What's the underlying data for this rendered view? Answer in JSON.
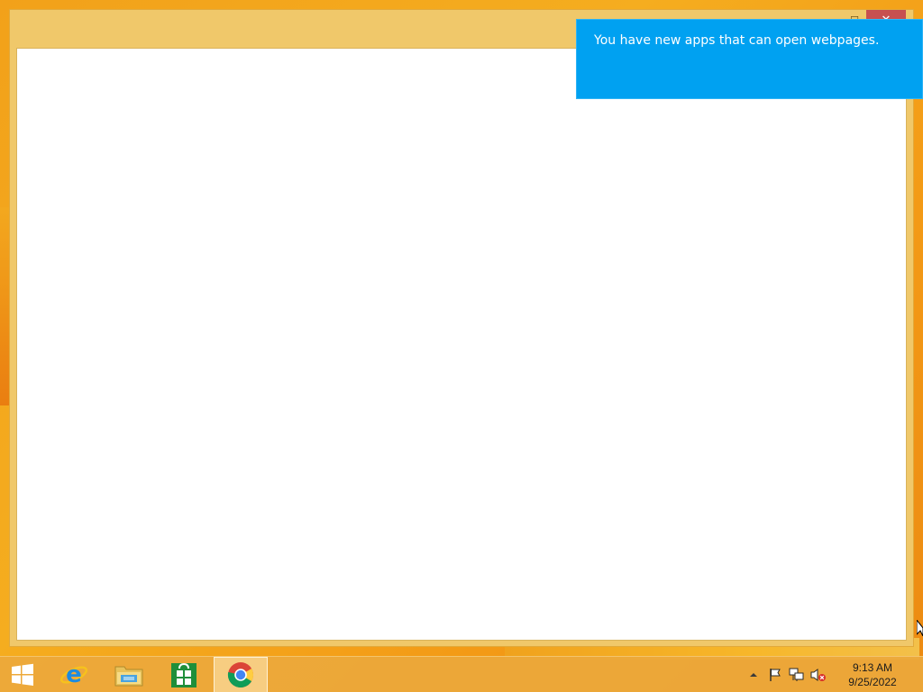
{
  "window": {
    "controls": {
      "maximize_glyph": "☐",
      "close_glyph": "✕"
    }
  },
  "toast": {
    "message": "You have new apps that can open webpages."
  },
  "taskbar": {
    "apps": [
      {
        "name": "internet-explorer",
        "icon": "ie-icon",
        "active": false
      },
      {
        "name": "file-explorer",
        "icon": "folder-icon",
        "active": false
      },
      {
        "name": "store",
        "icon": "store-icon",
        "active": false
      },
      {
        "name": "chrome",
        "icon": "chrome-icon",
        "active": true
      }
    ],
    "tray": {
      "icons": [
        "show-hidden-icons-icon",
        "action-center-flag-icon",
        "network-icon",
        "volume-muted-icon"
      ]
    },
    "clock": {
      "time": "9:13 AM",
      "date": "9/25/2022"
    }
  },
  "colors": {
    "desktop": "#f2a11a",
    "window_frame": "#f0c86a",
    "toast": "#00a1f1",
    "close_button": "#c75050"
  }
}
